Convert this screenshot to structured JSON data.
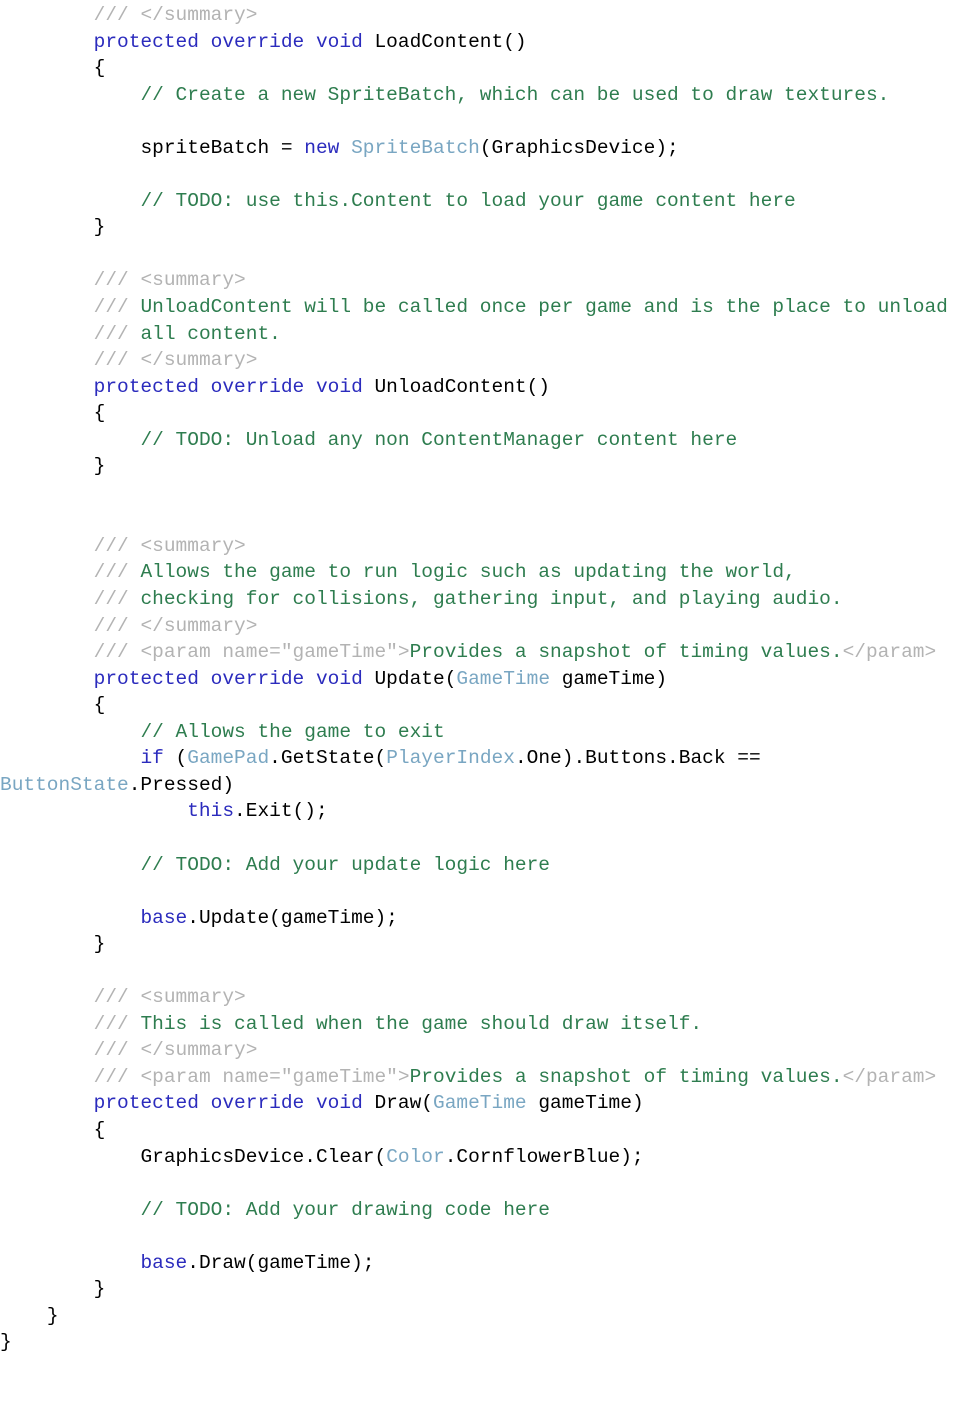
{
  "document": {
    "kind": "source-code-listing",
    "language": "C#",
    "background_color": "#ffffff"
  },
  "palette": {
    "plain": "#000000",
    "keyword": "#2b2bbd",
    "type": "#79a6c2",
    "comment": "#2e7d4f",
    "doc_tag": "#b3b3b3",
    "doc_text": "#2e7d4f"
  },
  "code": {
    "lines": [
      {
        "id": "l1",
        "tokens": [
          {
            "t": "        ",
            "c": "plain"
          },
          {
            "t": "/// ",
            "c": "docslash"
          },
          {
            "t": "</summary>",
            "c": "doctag"
          }
        ]
      },
      {
        "id": "l2",
        "tokens": [
          {
            "t": "        ",
            "c": "plain"
          },
          {
            "t": "protected override void ",
            "c": "keyword"
          },
          {
            "t": "LoadContent()",
            "c": "plain"
          }
        ]
      },
      {
        "id": "l3",
        "tokens": [
          {
            "t": "        {",
            "c": "plain"
          }
        ]
      },
      {
        "id": "l4",
        "tokens": [
          {
            "t": "            ",
            "c": "plain"
          },
          {
            "t": "// Create a new SpriteBatch, which can be used to draw textures.",
            "c": "comment"
          }
        ]
      },
      {
        "id": "l5",
        "tokens": [
          {
            "t": "",
            "c": "blank"
          }
        ]
      },
      {
        "id": "l6",
        "tokens": [
          {
            "t": "            spriteBatch = ",
            "c": "plain"
          },
          {
            "t": "new ",
            "c": "keyword"
          },
          {
            "t": "SpriteBatch",
            "c": "type"
          },
          {
            "t": "(GraphicsDevice);",
            "c": "plain"
          }
        ]
      },
      {
        "id": "l7",
        "tokens": [
          {
            "t": "",
            "c": "blank"
          }
        ]
      },
      {
        "id": "l8",
        "tokens": [
          {
            "t": "            ",
            "c": "plain"
          },
          {
            "t": "// TODO: use this.Content to load your game content here",
            "c": "comment"
          }
        ]
      },
      {
        "id": "l9",
        "tokens": [
          {
            "t": "        }",
            "c": "plain"
          }
        ]
      },
      {
        "id": "l10",
        "tokens": [
          {
            "t": "",
            "c": "blank"
          }
        ]
      },
      {
        "id": "l11",
        "tokens": [
          {
            "t": "        ",
            "c": "plain"
          },
          {
            "t": "/// ",
            "c": "docslash"
          },
          {
            "t": "<summary>",
            "c": "doctag"
          }
        ]
      },
      {
        "id": "l12",
        "tokens": [
          {
            "t": "        ",
            "c": "plain"
          },
          {
            "t": "/// ",
            "c": "docslash"
          },
          {
            "t": "UnloadContent will be called once per game and is the place to unload",
            "c": "doctext"
          }
        ]
      },
      {
        "id": "l13",
        "tokens": [
          {
            "t": "        ",
            "c": "plain"
          },
          {
            "t": "/// ",
            "c": "docslash"
          },
          {
            "t": "all content.",
            "c": "doctext"
          }
        ]
      },
      {
        "id": "l14",
        "tokens": [
          {
            "t": "        ",
            "c": "plain"
          },
          {
            "t": "/// ",
            "c": "docslash"
          },
          {
            "t": "</summary>",
            "c": "doctag"
          }
        ]
      },
      {
        "id": "l15",
        "tokens": [
          {
            "t": "        ",
            "c": "plain"
          },
          {
            "t": "protected override void ",
            "c": "keyword"
          },
          {
            "t": "UnloadContent()",
            "c": "plain"
          }
        ]
      },
      {
        "id": "l16",
        "tokens": [
          {
            "t": "        {",
            "c": "plain"
          }
        ]
      },
      {
        "id": "l17",
        "tokens": [
          {
            "t": "            ",
            "c": "plain"
          },
          {
            "t": "// TODO: Unload any non ContentManager content here",
            "c": "comment"
          }
        ]
      },
      {
        "id": "l18",
        "tokens": [
          {
            "t": "        }",
            "c": "plain"
          }
        ]
      },
      {
        "id": "l19",
        "tokens": [
          {
            "t": "",
            "c": "blank"
          }
        ]
      },
      {
        "id": "l20",
        "tokens": [
          {
            "t": "",
            "c": "blank"
          }
        ]
      },
      {
        "id": "l21",
        "tokens": [
          {
            "t": "        ",
            "c": "plain"
          },
          {
            "t": "/// ",
            "c": "docslash"
          },
          {
            "t": "<summary>",
            "c": "doctag"
          }
        ]
      },
      {
        "id": "l22",
        "tokens": [
          {
            "t": "        ",
            "c": "plain"
          },
          {
            "t": "/// ",
            "c": "docslash"
          },
          {
            "t": "Allows the game to run logic such as updating the world,",
            "c": "doctext"
          }
        ]
      },
      {
        "id": "l23",
        "tokens": [
          {
            "t": "        ",
            "c": "plain"
          },
          {
            "t": "/// ",
            "c": "docslash"
          },
          {
            "t": "checking for collisions, gathering input, and playing audio.",
            "c": "doctext"
          }
        ]
      },
      {
        "id": "l24",
        "tokens": [
          {
            "t": "        ",
            "c": "plain"
          },
          {
            "t": "/// ",
            "c": "docslash"
          },
          {
            "t": "</summary>",
            "c": "doctag"
          }
        ]
      },
      {
        "id": "l25",
        "tokens": [
          {
            "t": "        ",
            "c": "plain"
          },
          {
            "t": "/// ",
            "c": "docslash"
          },
          {
            "t": "<param name=\"gameTime\">",
            "c": "doctag"
          },
          {
            "t": "Provides a snapshot of timing values.",
            "c": "doctext"
          },
          {
            "t": "</param>",
            "c": "doctag"
          }
        ]
      },
      {
        "id": "l26",
        "tokens": [
          {
            "t": "        ",
            "c": "plain"
          },
          {
            "t": "protected override void ",
            "c": "keyword"
          },
          {
            "t": "Update(",
            "c": "plain"
          },
          {
            "t": "GameTime",
            "c": "type"
          },
          {
            "t": " gameTime)",
            "c": "plain"
          }
        ]
      },
      {
        "id": "l27",
        "tokens": [
          {
            "t": "        {",
            "c": "plain"
          }
        ]
      },
      {
        "id": "l28",
        "tokens": [
          {
            "t": "            ",
            "c": "plain"
          },
          {
            "t": "// Allows the game to exit",
            "c": "comment"
          }
        ]
      },
      {
        "id": "l29",
        "tokens": [
          {
            "t": "            ",
            "c": "plain"
          },
          {
            "t": "if",
            "c": "keyword"
          },
          {
            "t": " (",
            "c": "plain"
          },
          {
            "t": "GamePad",
            "c": "type"
          },
          {
            "t": ".GetState(",
            "c": "plain"
          },
          {
            "t": "PlayerIndex",
            "c": "type"
          },
          {
            "t": ".One).Buttons.Back == ",
            "c": "plain"
          },
          {
            "t": "ButtonState",
            "c": "type"
          },
          {
            "t": ".Pressed)",
            "c": "plain"
          }
        ]
      },
      {
        "id": "l30",
        "tokens": [
          {
            "t": "                ",
            "c": "plain"
          },
          {
            "t": "this",
            "c": "keyword"
          },
          {
            "t": ".Exit();",
            "c": "plain"
          }
        ]
      },
      {
        "id": "l31",
        "tokens": [
          {
            "t": "",
            "c": "blank"
          }
        ]
      },
      {
        "id": "l32",
        "tokens": [
          {
            "t": "            ",
            "c": "plain"
          },
          {
            "t": "// TODO: Add your update logic here",
            "c": "comment"
          }
        ]
      },
      {
        "id": "l33",
        "tokens": [
          {
            "t": "",
            "c": "blank"
          }
        ]
      },
      {
        "id": "l34",
        "tokens": [
          {
            "t": "            ",
            "c": "plain"
          },
          {
            "t": "base",
            "c": "keyword"
          },
          {
            "t": ".Update(gameTime);",
            "c": "plain"
          }
        ]
      },
      {
        "id": "l35",
        "tokens": [
          {
            "t": "        }",
            "c": "plain"
          }
        ]
      },
      {
        "id": "l36",
        "tokens": [
          {
            "t": "",
            "c": "blank"
          }
        ]
      },
      {
        "id": "l37",
        "tokens": [
          {
            "t": "        ",
            "c": "plain"
          },
          {
            "t": "/// ",
            "c": "docslash"
          },
          {
            "t": "<summary>",
            "c": "doctag"
          }
        ]
      },
      {
        "id": "l38",
        "tokens": [
          {
            "t": "        ",
            "c": "plain"
          },
          {
            "t": "/// ",
            "c": "docslash"
          },
          {
            "t": "This is called when the game should draw itself.",
            "c": "doctext"
          }
        ]
      },
      {
        "id": "l39",
        "tokens": [
          {
            "t": "        ",
            "c": "plain"
          },
          {
            "t": "/// ",
            "c": "docslash"
          },
          {
            "t": "</summary>",
            "c": "doctag"
          }
        ]
      },
      {
        "id": "l40",
        "tokens": [
          {
            "t": "        ",
            "c": "plain"
          },
          {
            "t": "/// ",
            "c": "docslash"
          },
          {
            "t": "<param name=\"gameTime\">",
            "c": "doctag"
          },
          {
            "t": "Provides a snapshot of timing values.",
            "c": "doctext"
          },
          {
            "t": "</param>",
            "c": "doctag"
          }
        ]
      },
      {
        "id": "l41",
        "tokens": [
          {
            "t": "        ",
            "c": "plain"
          },
          {
            "t": "protected override void ",
            "c": "keyword"
          },
          {
            "t": "Draw(",
            "c": "plain"
          },
          {
            "t": "GameTime",
            "c": "type"
          },
          {
            "t": " gameTime)",
            "c": "plain"
          }
        ]
      },
      {
        "id": "l42",
        "tokens": [
          {
            "t": "        {",
            "c": "plain"
          }
        ]
      },
      {
        "id": "l43",
        "tokens": [
          {
            "t": "            GraphicsDevice.Clear(",
            "c": "plain"
          },
          {
            "t": "Color",
            "c": "type"
          },
          {
            "t": ".CornflowerBlue);",
            "c": "plain"
          }
        ]
      },
      {
        "id": "l44",
        "tokens": [
          {
            "t": "",
            "c": "blank"
          }
        ]
      },
      {
        "id": "l45",
        "tokens": [
          {
            "t": "            ",
            "c": "plain"
          },
          {
            "t": "// TODO: Add your drawing code here",
            "c": "comment"
          }
        ]
      },
      {
        "id": "l46",
        "tokens": [
          {
            "t": "",
            "c": "blank"
          }
        ]
      },
      {
        "id": "l47",
        "tokens": [
          {
            "t": "            ",
            "c": "plain"
          },
          {
            "t": "base",
            "c": "keyword"
          },
          {
            "t": ".Draw(gameTime);",
            "c": "plain"
          }
        ]
      },
      {
        "id": "l48",
        "tokens": [
          {
            "t": "        }",
            "c": "plain"
          }
        ]
      },
      {
        "id": "l49",
        "tokens": [
          {
            "t": "    }",
            "c": "plain"
          }
        ]
      },
      {
        "id": "l50",
        "tokens": [
          {
            "t": "}",
            "c": "plain"
          }
        ]
      }
    ]
  }
}
